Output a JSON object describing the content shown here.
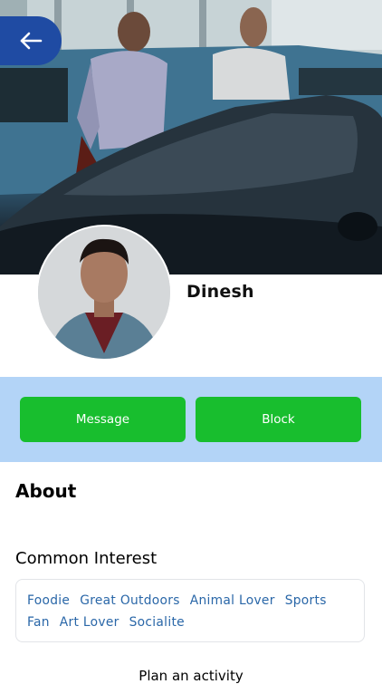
{
  "header": {
    "back_icon": "arrow-left-icon",
    "back_color": "#1f4ba3"
  },
  "profile": {
    "name": "Dinesh"
  },
  "actions": {
    "message_label": "Message",
    "block_label": "Block",
    "button_color": "#18be2e",
    "band_color": "#b3d4f7"
  },
  "about": {
    "title": "About"
  },
  "interests": {
    "title": "Common Interest",
    "items": [
      "Foodie",
      "Great Outdoors",
      "Animal Lover",
      "Sports",
      "Fan",
      "Art Lover",
      "Socialite"
    ],
    "chip_color": "#2a67a8"
  },
  "footer": {
    "plan_label": "Plan an activity"
  }
}
